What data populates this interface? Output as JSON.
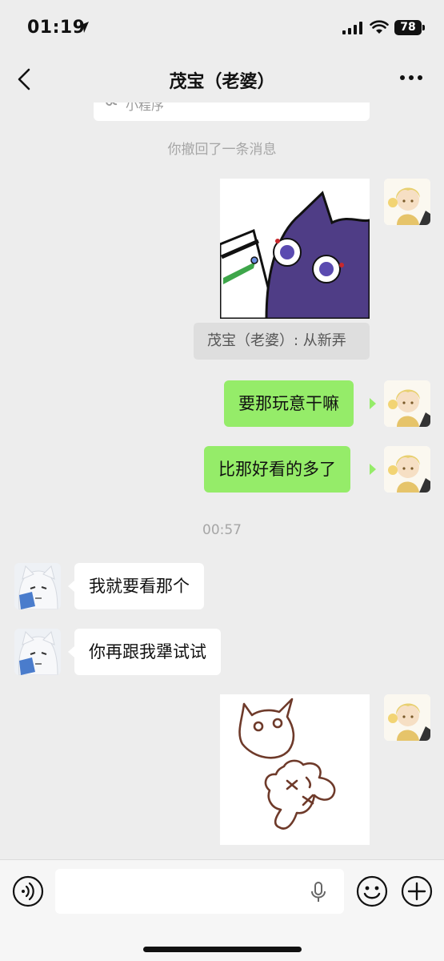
{
  "status_bar": {
    "time": "01:19",
    "battery": "78"
  },
  "header": {
    "title": "茂宝（老婆）"
  },
  "messages": {
    "mini_program_label": "小程序",
    "recalled_notice": "你撤回了一条消息",
    "quote_text": "茂宝（老婆）: 从新弄",
    "sent_1": "要那玩意干嘛",
    "sent_2": "比那好看的多了",
    "timestamp": "00:57",
    "received_1": "我就要看那个",
    "received_2": "你再跟我犟试试"
  },
  "input": {
    "placeholder": "",
    "value": ""
  },
  "colors": {
    "sent_bubble": "#95ec69",
    "received_bubble": "#ffffff",
    "background": "#ededed"
  }
}
